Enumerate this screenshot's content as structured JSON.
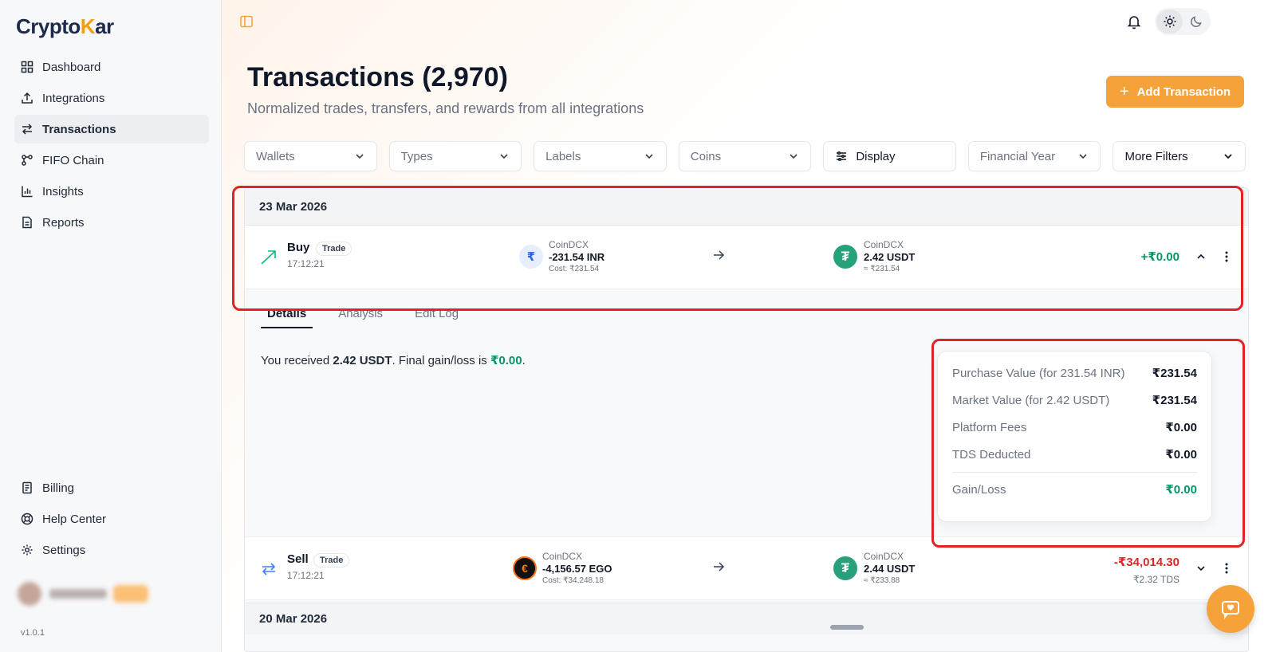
{
  "brand": {
    "logo_pre": "Crypto",
    "logo_k": "K",
    "logo_post": "ar"
  },
  "sidebar": {
    "items": [
      {
        "label": "Dashboard",
        "icon": "dashboard-icon"
      },
      {
        "label": "Integrations",
        "icon": "upload-icon"
      },
      {
        "label": "Transactions",
        "icon": "swap-icon",
        "active": true
      },
      {
        "label": "FIFO Chain",
        "icon": "chain-icon"
      },
      {
        "label": "Insights",
        "icon": "bar-chart-icon"
      },
      {
        "label": "Reports",
        "icon": "document-icon"
      }
    ],
    "bottom_items": [
      {
        "label": "Billing",
        "icon": "receipt-icon"
      },
      {
        "label": "Help Center",
        "icon": "lifebuoy-icon"
      },
      {
        "label": "Settings",
        "icon": "gear-icon"
      }
    ],
    "version": "v1.0.1"
  },
  "header": {
    "title": "Transactions (2,970)",
    "subtitle": "Normalized trades, transfers, and rewards from all integrations",
    "add_button": "Add Transaction"
  },
  "filters": [
    "Wallets",
    "Types",
    "Labels",
    "Coins",
    "Display",
    "Financial Year",
    "More Filters"
  ],
  "groups": [
    {
      "date": "23 Mar 2026"
    },
    {
      "date": "20 Mar 2026"
    }
  ],
  "transactions": [
    {
      "type": "Buy",
      "badge": "Trade",
      "time": "17:12:21",
      "from": {
        "source": "CoinDCX",
        "amount": "-231.54 INR",
        "sub": "Cost: ₹231.54"
      },
      "to": {
        "source": "CoinDCX",
        "amount": "2.42 USDT",
        "sub": "≈ ₹231.54"
      },
      "value": "+₹0.00",
      "expanded": true
    },
    {
      "type": "Sell",
      "badge": "Trade",
      "time": "17:12:21",
      "from": {
        "source": "CoinDCX",
        "amount": "-4,156.57 EGO",
        "sub": "Cost: ₹34,248.18"
      },
      "to": {
        "source": "CoinDCX",
        "amount": "2.44 USDT",
        "sub": "≈ ₹233.88"
      },
      "value": "-₹34,014.30",
      "tds": "₹2.32 TDS",
      "expanded": false
    }
  ],
  "details": {
    "tabs": [
      "Details",
      "Analysis",
      "Edit Log"
    ],
    "summary_pre": "You received ",
    "summary_bold": "2.42 USDT",
    "summary_mid": ". Final gain/loss is ",
    "summary_gain": "₹0.00",
    "summary_post": ".",
    "fees": [
      {
        "label": "Purchase Value (for 231.54 INR)",
        "value": "₹231.54"
      },
      {
        "label": "Market Value (for 2.42 USDT)",
        "value": "₹231.54"
      },
      {
        "label": "Platform Fees",
        "value": "₹0.00"
      },
      {
        "label": "TDS Deducted",
        "value": "₹0.00"
      }
    ],
    "gain_label": "Gain/Loss",
    "gain_value": "₹0.00"
  },
  "colors": {
    "accent": "#f5a23b",
    "positive": "#059669",
    "negative": "#dc2626",
    "highlight": "#e02424"
  }
}
